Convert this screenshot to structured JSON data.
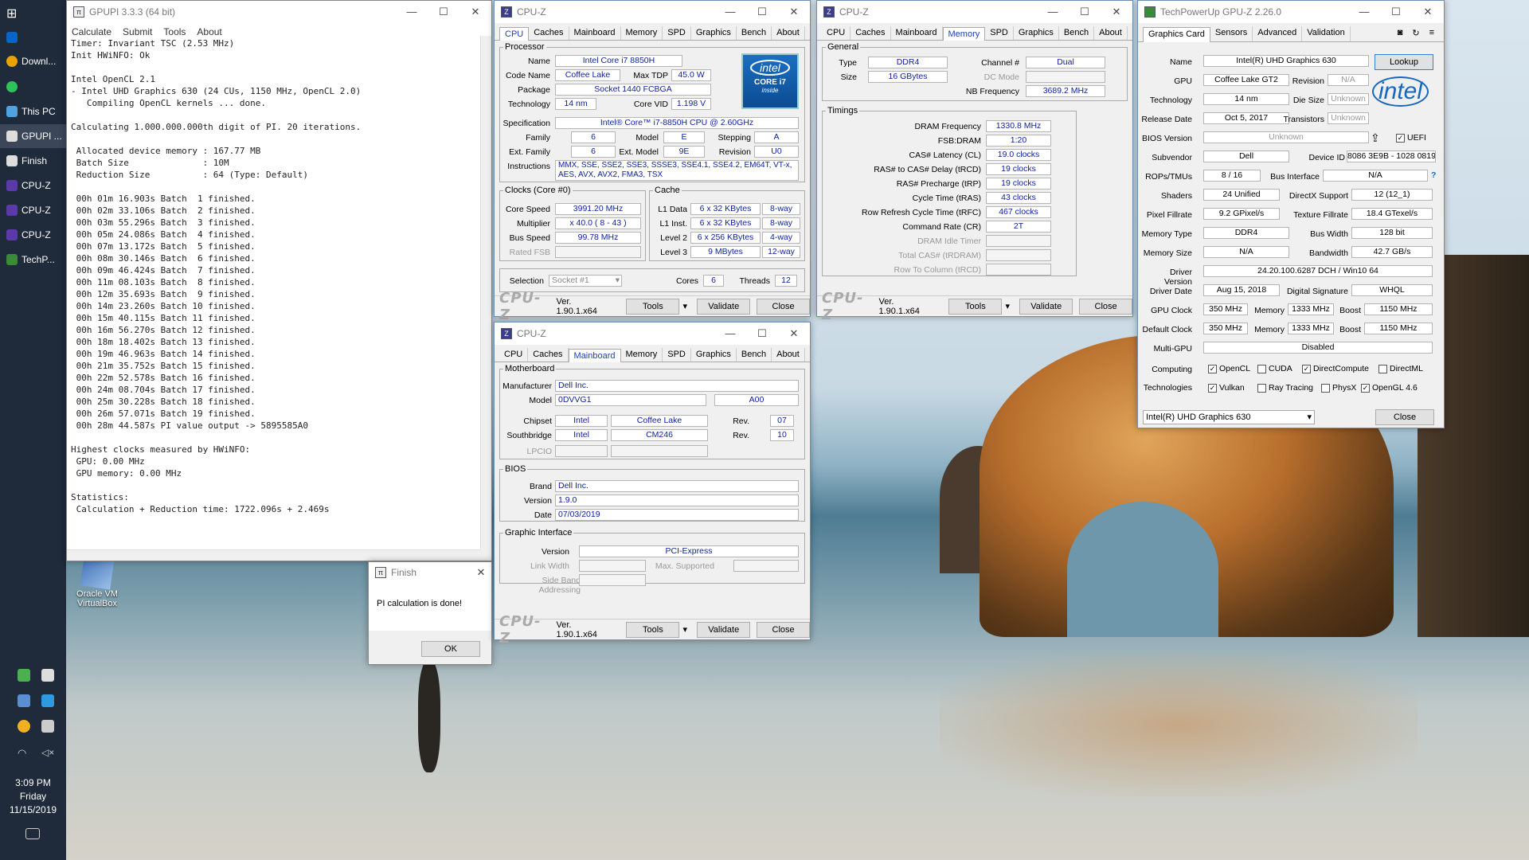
{
  "taskbar": {
    "items": [
      "Downl...",
      "This PC",
      "GPUPI ...",
      "Finish",
      "CPU-Z",
      "CPU-Z",
      "CPU-Z",
      "TechP..."
    ],
    "time": "3:09 PM",
    "day": "Friday",
    "date": "11/15/2019"
  },
  "desktop": {
    "icon_label": "Oracle VM VirtualBox"
  },
  "gpupi": {
    "title": "GPUPI 3.3.3 (64 bit)",
    "menu": [
      "Calculate",
      "Submit",
      "Tools",
      "About"
    ],
    "lines": [
      "Timer: Invariant TSC (2.53 MHz)",
      "Init HWiNFO: Ok",
      "",
      "Intel OpenCL 2.1",
      "- Intel UHD Graphics 630 (24 CUs, 1150 MHz, OpenCL 2.0)",
      "   Compiling OpenCL kernels ... done.",
      "",
      "Calculating 1.000.000.000th digit of PI. 20 iterations.",
      "",
      " Allocated device memory : 167.77 MB",
      " Batch Size              : 10M",
      " Reduction Size          : 64 (Type: Default)",
      "",
      " 00h 01m 16.903s Batch  1 finished.",
      " 00h 02m 33.106s Batch  2 finished.",
      " 00h 03m 55.296s Batch  3 finished.",
      " 00h 05m 24.086s Batch  4 finished.",
      " 00h 07m 13.172s Batch  5 finished.",
      " 00h 08m 30.146s Batch  6 finished.",
      " 00h 09m 46.424s Batch  7 finished.",
      " 00h 11m 08.103s Batch  8 finished.",
      " 00h 12m 35.693s Batch  9 finished.",
      " 00h 14m 23.260s Batch 10 finished.",
      " 00h 15m 40.115s Batch 11 finished.",
      " 00h 16m 56.270s Batch 12 finished.",
      " 00h 18m 18.402s Batch 13 finished.",
      " 00h 19m 46.963s Batch 14 finished.",
      " 00h 21m 35.752s Batch 15 finished.",
      " 00h 22m 52.578s Batch 16 finished.",
      " 00h 24m 08.704s Batch 17 finished.",
      " 00h 25m 30.228s Batch 18 finished.",
      " 00h 26m 57.071s Batch 19 finished.",
      " 00h 28m 44.587s PI value output -> 5895585A0",
      "",
      "Highest clocks measured by HWiNFO:",
      " GPU: 0.00 MHz",
      " GPU memory: 0.00 MHz",
      "",
      "Statistics:",
      " Calculation + Reduction time: 1722.096s + 2.469s"
    ]
  },
  "finish": {
    "title": "Finish",
    "message": "PI calculation is done!",
    "ok": "OK"
  },
  "cpuz_common": {
    "title": "CPU-Z",
    "tabs": [
      "CPU",
      "Caches",
      "Mainboard",
      "Memory",
      "SPD",
      "Graphics",
      "Bench",
      "About"
    ],
    "brand": "CPU-Z",
    "version": "Ver. 1.90.1.x64",
    "tools": "Tools",
    "validate": "Validate",
    "close": "Close"
  },
  "cpuz1": {
    "processor_legend": "Processor",
    "name_l": "Name",
    "name": "Intel Core i7 8850H",
    "codename_l": "Code Name",
    "codename": "Coffee Lake",
    "maxtdp_l": "Max TDP",
    "maxtdp": "45.0 W",
    "package_l": "Package",
    "package": "Socket 1440 FCBGA",
    "tech_l": "Technology",
    "tech": "14 nm",
    "corevid_l": "Core VID",
    "corevid": "1.198 V",
    "spec_l": "Specification",
    "spec": "Intel® Core™ i7-8850H CPU @ 2.60GHz",
    "family_l": "Family",
    "family": "6",
    "model_l": "Model",
    "model": "E",
    "stepping_l": "Stepping",
    "stepping": "A",
    "extfam_l": "Ext. Family",
    "extfam": "6",
    "extmodel_l": "Ext. Model",
    "extmodel": "9E",
    "revision_l": "Revision",
    "revision": "U0",
    "instr_l": "Instructions",
    "instr": "MMX, SSE, SSE2, SSE3, SSSE3, SSE4.1, SSE4.2, EM64T, VT-x, AES, AVX, AVX2, FMA3, TSX",
    "clocks_legend": "Clocks (Core #0)",
    "corespeed_l": "Core Speed",
    "corespeed": "3991.20 MHz",
    "mult_l": "Multiplier",
    "mult": "x 40.0 ( 8 - 43 )",
    "bus_l": "Bus Speed",
    "bus": "99.78 MHz",
    "fsb_l": "Rated FSB",
    "cache_legend": "Cache",
    "l1d_l": "L1 Data",
    "l1d": "6 x 32 KBytes",
    "l1d_w": "8-way",
    "l1i_l": "L1 Inst.",
    "l1i": "6 x 32 KBytes",
    "l1i_w": "8-way",
    "l2_l": "Level 2",
    "l2": "6 x 256 KBytes",
    "l2_w": "4-way",
    "l3_l": "Level 3",
    "l3": "9 MBytes",
    "l3_w": "12-way",
    "selection_l": "Selection",
    "selection": "Socket #1",
    "cores_l": "Cores",
    "cores": "6",
    "threads_l": "Threads",
    "threads": "12",
    "logo_top": "intel",
    "logo_mid": "CORE i7",
    "logo_bot": "inside"
  },
  "cpuz2": {
    "general_legend": "General",
    "type_l": "Type",
    "type": "DDR4",
    "channel_l": "Channel #",
    "channel": "Dual",
    "size_l": "Size",
    "size": "16 GBytes",
    "dcmode_l": "DC Mode",
    "nbfreq_l": "NB Frequency",
    "nbfreq": "3689.2 MHz",
    "timings_legend": "Timings",
    "t": [
      [
        "DRAM Frequency",
        "1330.8 MHz"
      ],
      [
        "FSB:DRAM",
        "1:20"
      ],
      [
        "CAS# Latency (CL)",
        "19.0 clocks"
      ],
      [
        "RAS# to CAS# Delay (tRCD)",
        "19 clocks"
      ],
      [
        "RAS# Precharge (tRP)",
        "19 clocks"
      ],
      [
        "Cycle Time (tRAS)",
        "43 clocks"
      ],
      [
        "Row Refresh Cycle Time (tRFC)",
        "467 clocks"
      ],
      [
        "Command Rate (CR)",
        "2T"
      ],
      [
        "DRAM Idle Timer",
        ""
      ],
      [
        "Total CAS# (tRDRAM)",
        ""
      ],
      [
        "Row To Column (tRCD)",
        ""
      ]
    ]
  },
  "cpuz3": {
    "mb_legend": "Motherboard",
    "manuf_l": "Manufacturer",
    "manuf": "Dell Inc.",
    "model_l": "Model",
    "model": "0DVVG1",
    "model_rev": "A00",
    "chipset_l": "Chipset",
    "chipset_v": "Intel",
    "chipset_n": "Coffee Lake",
    "rev_l": "Rev.",
    "chipset_r": "07",
    "south_l": "Southbridge",
    "south_v": "Intel",
    "south_n": "CM246",
    "south_r": "10",
    "lpcio_l": "LPCIO",
    "bios_legend": "BIOS",
    "brand_l": "Brand",
    "brand": "Dell Inc.",
    "version_l": "Version",
    "version": "1.9.0",
    "date_l": "Date",
    "date": "07/03/2019",
    "gi_legend": "Graphic Interface",
    "giver_l": "Version",
    "giver": "PCI-Express",
    "lw_l": "Link Width",
    "maxs_l": "Max. Supported",
    "sba_l": "Side Band Addressing"
  },
  "gpuz": {
    "title": "TechPowerUp GPU-Z 2.26.0",
    "tabs": [
      "Graphics Card",
      "Sensors",
      "Advanced",
      "Validation"
    ],
    "lookup": "Lookup",
    "logo": "intel",
    "name_l": "Name",
    "name": "Intel(R) UHD Graphics 630",
    "gpu_l": "GPU",
    "gpu": "Coffee Lake GT2",
    "revision_l": "Revision",
    "revision": "N/A",
    "tech_l": "Technology",
    "tech": "14 nm",
    "die_l": "Die Size",
    "die": "Unknown",
    "rel_l": "Release Date",
    "rel": "Oct 5, 2017",
    "trans_l": "Transistors",
    "trans": "Unknown",
    "bios_l": "BIOS Version",
    "bios": "Unknown",
    "uefi": "UEFI",
    "subv_l": "Subvendor",
    "subv": "Dell",
    "devid_l": "Device ID",
    "devid": "8086 3E9B - 1028 0819",
    "rops_l": "ROPs/TMUs",
    "rops": "8 / 16",
    "busif_l": "Bus Interface",
    "busif": "N/A",
    "qmark": "?",
    "shaders_l": "Shaders",
    "shaders": "24 Unified",
    "dx_l": "DirectX Support",
    "dx": "12 (12_1)",
    "pix_l": "Pixel Fillrate",
    "pix": "9.2 GPixel/s",
    "tex_l": "Texture Fillrate",
    "tex": "18.4 GTexel/s",
    "memtype_l": "Memory Type",
    "memtype": "DDR4",
    "buswidth_l": "Bus Width",
    "buswidth": "128 bit",
    "memsize_l": "Memory Size",
    "memsize": "N/A",
    "bandwidth_l": "Bandwidth",
    "bandwidth": "42.7 GB/s",
    "driver_l": "Driver Version",
    "driver": "24.20.100.6287 DCH / Win10 64",
    "ddate_l": "Driver Date",
    "ddate": "Aug 15, 2018",
    "dsig_l": "Digital Signature",
    "dsig": "WHQL",
    "gpuclk_l": "GPU Clock",
    "gpuclk": "350 MHz",
    "mem_l": "Memory",
    "memclk": "1333 MHz",
    "boost_l": "Boost",
    "boost": "1150 MHz",
    "defclk_l": "Default Clock",
    "defclk": "350 MHz",
    "defmem": "1333 MHz",
    "defboost": "1150 MHz",
    "multi_l": "Multi-GPU",
    "multi": "Disabled",
    "comp_l": "Computing",
    "tech2_l": "Technologies",
    "opencl": "OpenCL",
    "cuda": "CUDA",
    "dcompute": "DirectCompute",
    "directml": "DirectML",
    "vulkan": "Vulkan",
    "raytr": "Ray Tracing",
    "physx": "PhysX",
    "opengl": "OpenGL 4.6",
    "select": "Intel(R) UHD Graphics 630",
    "close": "Close"
  }
}
